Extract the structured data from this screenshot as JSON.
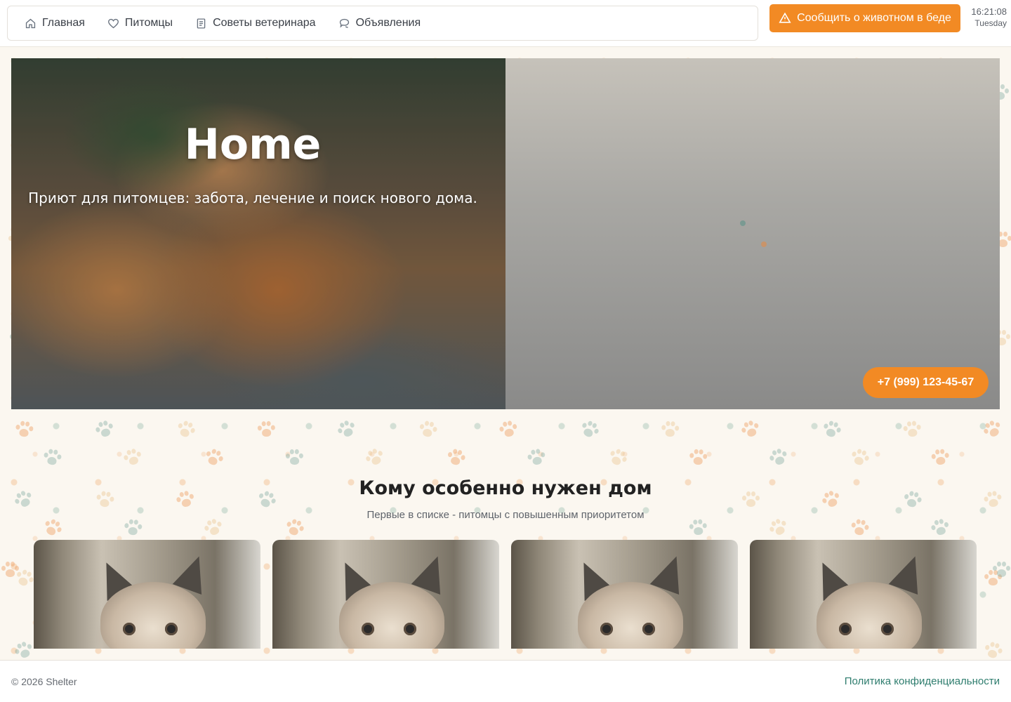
{
  "nav": {
    "items": [
      {
        "label": "Главная",
        "icon": "home-icon"
      },
      {
        "label": "Питомцы",
        "icon": "heart-icon"
      },
      {
        "label": "Советы ветеринара",
        "icon": "document-icon"
      },
      {
        "label": "Объявления",
        "icon": "chat-icon"
      }
    ]
  },
  "header": {
    "alert_label": "Сообщить о животном в беде",
    "alert_icon": "warning-icon",
    "time": "16:21:08",
    "day": "Tuesday"
  },
  "hero": {
    "title": "Home",
    "subtitle": "Приют для питомцев: забота, лечение и поиск нового дома.",
    "phone": "+7 (999) 123-45-67"
  },
  "section": {
    "title": "Кому особенно нужен дом",
    "subtitle": "Первые в списке - питомцы с повышенным приоритетом",
    "cards_count_visible": 4
  },
  "footer": {
    "copyright": "© 2026 Shelter",
    "privacy": "Политика конфиденциальности"
  },
  "colors": {
    "accent": "#f28a24",
    "link": "#2e7d6e",
    "background": "#fbf7f0"
  }
}
